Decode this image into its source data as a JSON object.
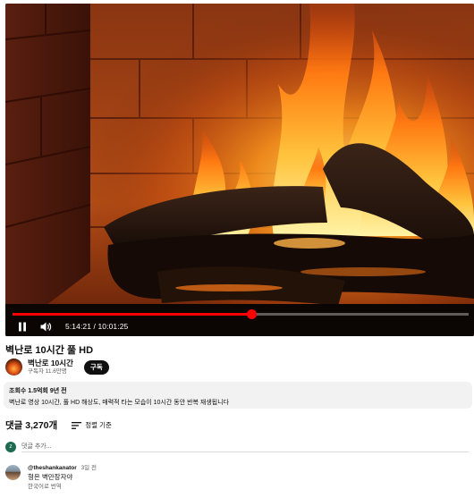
{
  "player": {
    "current_time": "5:14:21",
    "duration": "10:01:25",
    "progress": 0.523,
    "progress_color": "#ff0000"
  },
  "video": {
    "title": "벽난로 10시간 풀 HD"
  },
  "channel": {
    "name": "벽난로 10시간",
    "subscribers": "구독자 11.6만명",
    "subscribe_label": "구독"
  },
  "description": {
    "meta": "조회수 1.5억회  9년 전",
    "text": "벽난로 영상 10시간, 풀 HD 해상도, 매력적 타는 모습이 10시간 동안 반복 재생됩니다"
  },
  "comments": {
    "count_label": "댓글 3,270개",
    "sort_label": "정렬 기준",
    "add_placeholder": "댓글 추가...",
    "me_initial": "z",
    "items": [
      {
        "author": "@theshankanator",
        "age": "3일 전",
        "text": "형은 벽만장자야",
        "translate": "한국어로 번역"
      }
    ]
  },
  "icons": {
    "play_pause": "pause-icon",
    "volume": "volume-icon",
    "sort": "sort-icon"
  }
}
